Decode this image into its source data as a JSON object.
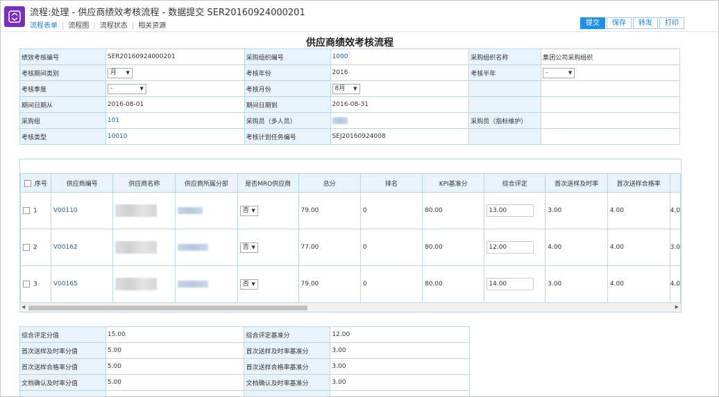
{
  "header": {
    "title": "流程:处理 - 供应商绩效考核流程 - 数据提交 SER20160924000201",
    "nav": [
      "流程表单",
      "流程图",
      "流程状态",
      "相关资源"
    ],
    "buttons": [
      "提交",
      "保存",
      "转发",
      "打印"
    ]
  },
  "form_title": "供应商绩效考核流程",
  "info": {
    "r1": [
      "绩效考核编号",
      "SER20160924000201",
      "采购组织编号",
      "1000",
      "采购组织名称",
      "集团公司采购组织"
    ],
    "r2": [
      "考核期间类别",
      "月",
      "考核年份",
      "2016",
      "考核半年",
      "-"
    ],
    "r3": [
      "考核季度",
      "-",
      "考核月份",
      "8月"
    ],
    "r4": [
      "期间日期从",
      "2016-08-01",
      "期间日期到",
      "2016-08-31"
    ],
    "r5": [
      "采购组",
      "101",
      "采购员（多人员）",
      "",
      "采购员（指标维护）"
    ],
    "r6": [
      "考核类型",
      "10010",
      "考核计划任务编号",
      "SEJ20160924008"
    ]
  },
  "grid": {
    "headers": [
      "序号",
      "供应商编号",
      "供应商名称",
      "供应商所属分部",
      "是否MRO供应商",
      "总分",
      "排名",
      "KPI基准分",
      "综合评定",
      "首次送样及时率",
      "首次送样合格率"
    ],
    "rows": [
      {
        "no": "1",
        "code": "V00110",
        "mro": "否",
        "total": "79.00",
        "rank": "0",
        "kpi": "80.00",
        "eval": "13.00",
        "r1": "3.00",
        "r2": "4.00",
        "cut": "4.0"
      },
      {
        "no": "2",
        "code": "V00162",
        "mro": "否",
        "total": "77.00",
        "rank": "0",
        "kpi": "80.00",
        "eval": "12.00",
        "r1": "4.00",
        "r2": "4.00",
        "cut": "3.0"
      },
      {
        "no": "3",
        "code": "V00165",
        "mro": "否",
        "total": "79.00",
        "rank": "0",
        "kpi": "80.00",
        "eval": "14.00",
        "r1": "3.00",
        "r2": "4.00",
        "cut": "4.0"
      }
    ]
  },
  "score": {
    "r1": [
      "综合评定分值",
      "15.00",
      "综合评定基准分",
      "12.00"
    ],
    "r2": [
      "首次送样及时率分值",
      "5.00",
      "首次送样及时率基准分",
      "3.00"
    ],
    "r3": [
      "首次送样合格率分值",
      "5.00",
      "首次送样合格率基准分",
      "3.00"
    ],
    "r4": [
      "文档确认及时率分值",
      "5.00",
      "文档确认及时率基准分",
      "3.00"
    ]
  }
}
